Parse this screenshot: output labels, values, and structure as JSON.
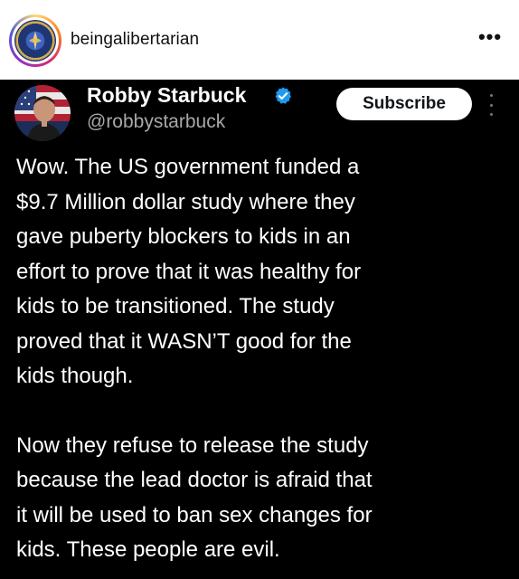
{
  "instagram": {
    "username": "beingalibertarian",
    "more_icon": "more-horizontal-icon",
    "more_glyph": "•••"
  },
  "tweet": {
    "display_name": "Robby Starbuck",
    "handle": "@robbystarbuck",
    "verified_color": "#1d9bf0",
    "subscribe_label": "Subscribe",
    "paragraphs": [
      "Wow. The US government funded a\n$9.7 Million dollar study where they\ngave puberty blockers to kids in an\neffort to prove that it was healthy for\nkids to be transitioned. The study\nproved that it WASN’T good for the\nkids though.",
      "Now they refuse to release the study\nbecause the lead doctor is afraid that\nit will be used to ban sex changes for\nkids. These people are evil."
    ]
  }
}
